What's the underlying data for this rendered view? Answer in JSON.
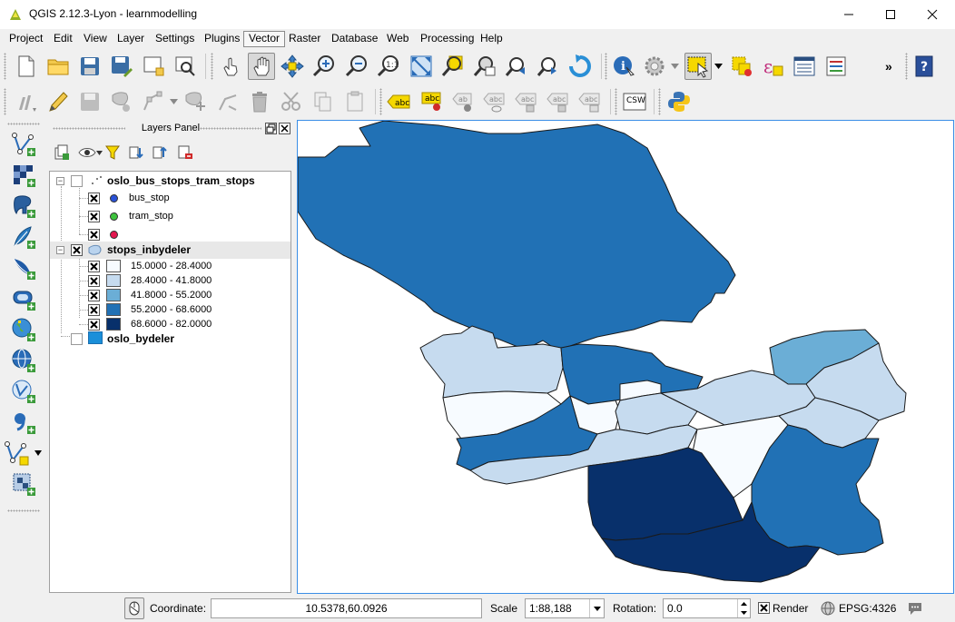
{
  "window": {
    "title": "QGIS 2.12.3-Lyon - learnmodelling"
  },
  "menubar": {
    "items": [
      "Project",
      "Edit",
      "View",
      "Layer",
      "Settings",
      "Plugins",
      "Vector",
      "Raster",
      "Database",
      "Web",
      "Processing",
      "Help"
    ],
    "active": "Vector"
  },
  "toolbar": {
    "overflow_label": "»",
    "label_button_text": "abc",
    "csw_label": "CSW"
  },
  "layers_panel": {
    "title": "Layers Panel",
    "layers": [
      {
        "name": "oslo_bus_stops_tram_stops",
        "visible": false,
        "symbols": [
          {
            "label": "bus_stop",
            "color": "#2a52d8",
            "checked": true
          },
          {
            "label": "tram_stop",
            "color": "#3ec43e",
            "checked": true
          },
          {
            "label": "",
            "color": "#e3164f",
            "checked": true
          }
        ]
      },
      {
        "name": "stops_inbydeler",
        "visible": true,
        "classes": [
          {
            "label": "15.0000 - 28.4000",
            "color": "#f7fbff",
            "checked": true
          },
          {
            "label": "28.4000 - 41.8000",
            "color": "#c6dbef",
            "checked": true
          },
          {
            "label": "41.8000 - 55.2000",
            "color": "#6baed6",
            "checked": true
          },
          {
            "label": "55.2000 - 68.6000",
            "color": "#2171b5",
            "checked": true
          },
          {
            "label": "68.6000 - 82.0000",
            "color": "#08306b",
            "checked": true
          }
        ]
      },
      {
        "name": "oslo_bydeler",
        "visible": false,
        "color": "#1a8fd9"
      }
    ]
  },
  "statusbar": {
    "coordinate_label": "Coordinate:",
    "coordinate_value": "10.5378,60.0926",
    "scale_label": "Scale",
    "scale_value": "1:88,188",
    "rotation_label": "Rotation:",
    "rotation_value": "0.0",
    "render_label": "Render",
    "render_checked": true,
    "crs_label": "EPSG:4326"
  },
  "colors": {
    "class_1": "#f7fbff",
    "class_2": "#c6dbef",
    "class_3": "#6baed6",
    "class_4": "#2171b5",
    "class_5": "#08306b",
    "map_border": "#3a8ee6"
  }
}
